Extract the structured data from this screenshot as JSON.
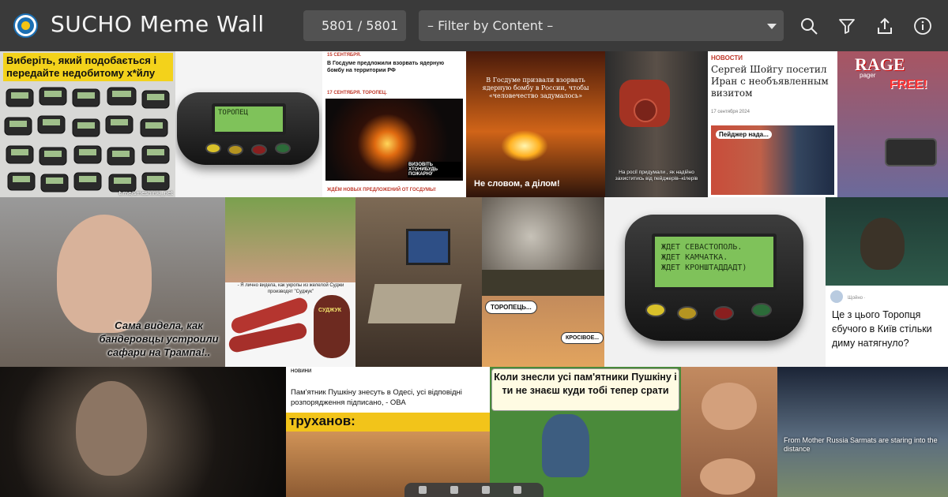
{
  "app": {
    "title": "SUCHO Meme Wall",
    "counter": "5801 / 5801",
    "filter_label": "– Filter by Content –"
  },
  "toolbar_icons": [
    "search-icon",
    "filter-icon",
    "share-icon",
    "info-icon"
  ],
  "colors": {
    "topbar": "#3a3a3a",
    "control": "#525252",
    "logo_blue": "#1b6fb3",
    "logo_yellow": "#f2c314",
    "pager_screen": "#7fc25a"
  },
  "watermark": "t.me/smeshinki_net",
  "tiles": {
    "t1": {
      "caption": "Виберіть, який подобається і передайте недобитому х*йлу"
    },
    "t2": {
      "screen": "ТОРОПЕЦ"
    },
    "t3": {
      "date1": "15 СЕНТЯБРЯ.",
      "headline1": "В Госдуме предложили взорвать ядерную бомбу на территории РФ",
      "date2": "17 СЕНТЯБРЯ. ТОРОПЕЦ.",
      "person_label": "ВИЗОВІТЬ ХТОНИБУДЬ ПОЖАРНУ",
      "footer": "ЖДЁМ НОВЫХ ПРЕДЛОЖЕНИЙ ОТ ГОСДУМЫ!"
    },
    "t4": {
      "headline": "В Госдуме призвали взорвать ядерную бомбу в России, чтобы «человечество задумалось»",
      "caption": "Не словом, а ділом!"
    },
    "t5": {
      "caption": "На росії придумали , як надійно захиститись від пейджерів--кілерів"
    },
    "t6": {
      "tag": "НОВОСТИ",
      "headline": "Сергей Шойгу посетил Иран с необъявленным визитом",
      "date": "17 сентября 2024",
      "bubble": "Пейджер нада..."
    },
    "t7": {
      "brand": "RAGE",
      "sub": "pager",
      "free": "FREE!"
    },
    "t8": {
      "caption": "Сама видела, как бандеровцы устроили сафари на Трампа!.."
    },
    "t9": {
      "caption": "- Я лично видела, как укропы из желелой Суджи производят \"Суджук\"",
      "label": "СУДЖУК"
    },
    "t11a": {},
    "t11b": {
      "bubble1": "ТОРОПЕЦЬ...",
      "bubble2": "КРОСІВОЕ..."
    },
    "t12": {
      "line1": "ЖДЕТ СЕВАСТОПОЛЬ.",
      "line2": "ЖДЕТ КАМЧАТКА.",
      "line3": "ЖДЕТ КРОНШТАДДАДТ)"
    },
    "t14": {
      "post": "Це з цього Торопця єбучого в Київ стільки диму натягнуло?",
      "meta": "Щойно ·"
    },
    "t16": {
      "header": "НОВИНИ",
      "headline": "Пам'ятник Пушкіну знесуть в Одесі, усі відповідні розпорядження підписано, - ОВА",
      "banner": "труханов:"
    },
    "t17": {
      "caption": "Коли знесли усі пам'ятники Пушкіну і ти не знаєш куди тобі тепер срати"
    },
    "t19": {
      "caption": "From Mother Russia Sarmats are staring into the distance"
    }
  }
}
